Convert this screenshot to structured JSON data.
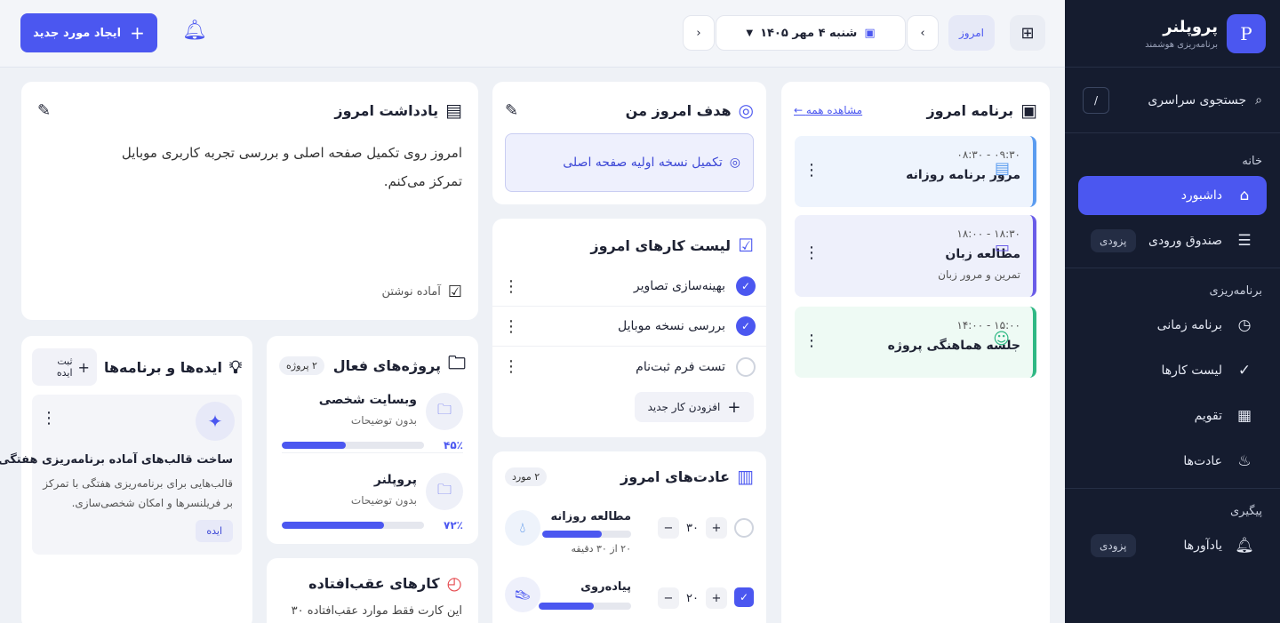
{
  "sidebar": {
    "brand_initial": "P",
    "brand_name": "پروپلنر",
    "brand_sub": "برنامه‌ریزی هوشمند",
    "search_label": "جستجوی سراسری",
    "search_kbd": "/",
    "home_title": "خانه",
    "home_items": [
      {
        "label": "داشبورد",
        "icon": "home-icon"
      },
      {
        "label": "صندوق ورودی",
        "icon": "inbox-icon",
        "badge": "پزودی"
      }
    ],
    "planning_title": "برنامه‌ریزی",
    "planning_items": [
      {
        "label": "برنامه زمانی",
        "icon": "clock-icon"
      },
      {
        "label": "لیست کارها",
        "icon": "check-icon"
      },
      {
        "label": "تقویم",
        "icon": "calendar-grid-icon"
      },
      {
        "label": "عادت‌ها",
        "icon": "sprout-icon"
      }
    ],
    "tracking_title": "پیگیری",
    "tracking_items": [
      {
        "label": "یادآورها",
        "icon": "bell-icon",
        "badge": "پزودی"
      }
    ]
  },
  "topbar": {
    "today_label": "امروز",
    "date_label": "شنبه ۴ مهر ۱۴۰۵",
    "create_label": "ایجاد مورد جدید"
  },
  "schedule": {
    "title": "برنامه امروز",
    "view_all": "مشاهده همه",
    "items": [
      {
        "time": "۰۹:۳۰ - ۰۸:۳۰",
        "name": "مرور برنامه روزانه",
        "sub": "",
        "color": "#5b9cf0",
        "bg": "#eef4fd",
        "icon": "document-icon"
      },
      {
        "time": "۱۸:۳۰ - ۱۸:۰۰",
        "name": "مطالعه زبان",
        "sub": "تمرین و مرور زبان",
        "color": "#6a5ce8",
        "bg": "#eef0fb",
        "icon": "laptop-icon"
      },
      {
        "time": "۱۵:۰۰ - ۱۴:۰۰",
        "name": "جلسه هماهنگی پروژه",
        "sub": "",
        "color": "#2fb884",
        "bg": "#eefaf4",
        "icon": "team-icon"
      }
    ]
  },
  "goal": {
    "title": "هدف امروز من",
    "text": "تکمیل نسخه اولیه صفحه اصلی"
  },
  "tasks": {
    "title": "لیست کارهای امروز",
    "items": [
      {
        "label": "بهینه‌سازی تصاویر",
        "done": true
      },
      {
        "label": "بررسی نسخه موبایل",
        "done": true
      },
      {
        "label": "تست فرم ثبت‌نام",
        "done": false
      }
    ],
    "add_label": "افزودن کار جدید"
  },
  "habits": {
    "title": "عادت‌های امروز",
    "badge": "۲ مورد",
    "items": [
      {
        "name": "مطالعه روزانه",
        "value": "۳۰",
        "progress": 0.67,
        "sub": "۲۰ از ۳۰ دقیقه",
        "icon": "drop-icon",
        "done": false
      },
      {
        "name": "پیاده‌روی",
        "value": "۲۰",
        "progress": 0.6,
        "sub": "",
        "icon": "shoe-icon",
        "done": true
      }
    ]
  },
  "note": {
    "title": "یادداشت امروز",
    "text": "امروز روی تکمیل صفحه اصلی و بررسی تجربه کاربری موبایل تمرکز می‌کنم.",
    "status": "آماده نوشتن"
  },
  "projects": {
    "title": "پروژه‌های فعال",
    "badge": "۲ پروژه",
    "items": [
      {
        "name": "وبسایت شخصی",
        "sub": "بدون توضیحات",
        "percent": "۴۵٪",
        "progress": 0.45
      },
      {
        "name": "پروپلنر",
        "sub": "بدون توضیحات",
        "percent": "۷۲٪",
        "progress": 0.72
      }
    ]
  },
  "ideas": {
    "title": "ایده‌ها و برنامه‌ها",
    "add_label": "ثبت ایده",
    "card": {
      "title": "ساخت قالب‌های آماده برنامه‌ریزی هفتگی",
      "text": "قالب‌هایی برای برنامه‌ریزی هفتگی با تمرکز بر فریلنسرها و امکان شخصی‌سازی.",
      "tag": "ایده"
    }
  },
  "overdue": {
    "title": "کارهای عقب‌افتاده",
    "text": "این کارت فقط موارد عقب‌افتاده ۳۰"
  }
}
